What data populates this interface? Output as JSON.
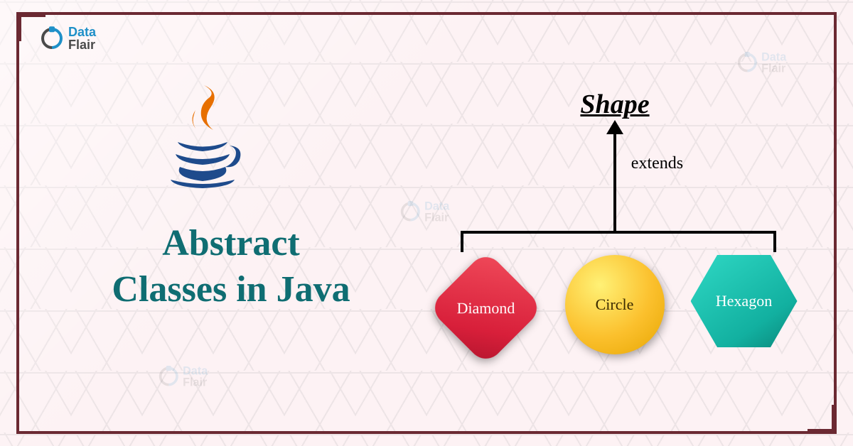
{
  "brand": {
    "name_top": "Data",
    "name_bottom": "Flair"
  },
  "title": {
    "line1": "Abstract",
    "line2": "Classes in Java"
  },
  "hierarchy": {
    "parent": "Shape",
    "relationship": "extends",
    "children": [
      {
        "label": "Diamond",
        "shape": "diamond",
        "color": "#d81f3a"
      },
      {
        "label": "Circle",
        "shape": "circle",
        "color": "#fbc02d"
      },
      {
        "label": "Hexagon",
        "shape": "hexagon",
        "color": "#12b0a0"
      }
    ]
  },
  "colors": {
    "frame": "#6b2932",
    "title": "#0f6d72",
    "logo_primary": "#1e90c8",
    "logo_secondary": "#4a4a4a"
  }
}
